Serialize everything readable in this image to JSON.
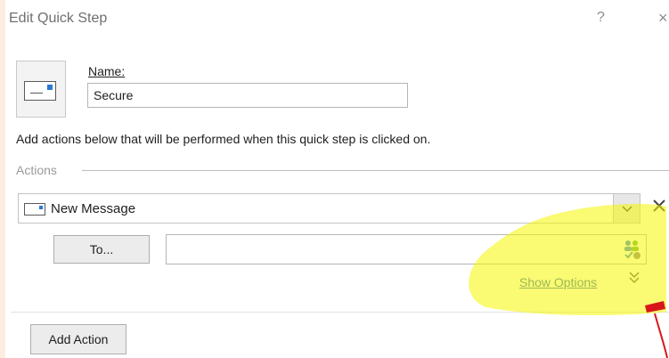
{
  "dialog": {
    "title": "Edit Quick Step",
    "help_glyph": "?",
    "close_glyph": "×"
  },
  "name_section": {
    "label": "Name:",
    "value": "Secure",
    "icon": "envelope-icon"
  },
  "description": "Add actions below that will be performed when this quick step is clicked on.",
  "actions_section": {
    "label": "Actions",
    "action": {
      "label": "New Message",
      "icon": "envelope-icon",
      "dropdown_glyph": "⌄",
      "remove_glyph": "✕"
    },
    "to_button": "To...",
    "to_value": "",
    "address_book_icon": "address-book-icon",
    "show_options": "Show Options",
    "expand_glyph": "⌄⌄"
  },
  "add_action_button": "Add Action",
  "annotation": {
    "highlight_color": "#f5f500",
    "pen_color": "#d8171b"
  }
}
